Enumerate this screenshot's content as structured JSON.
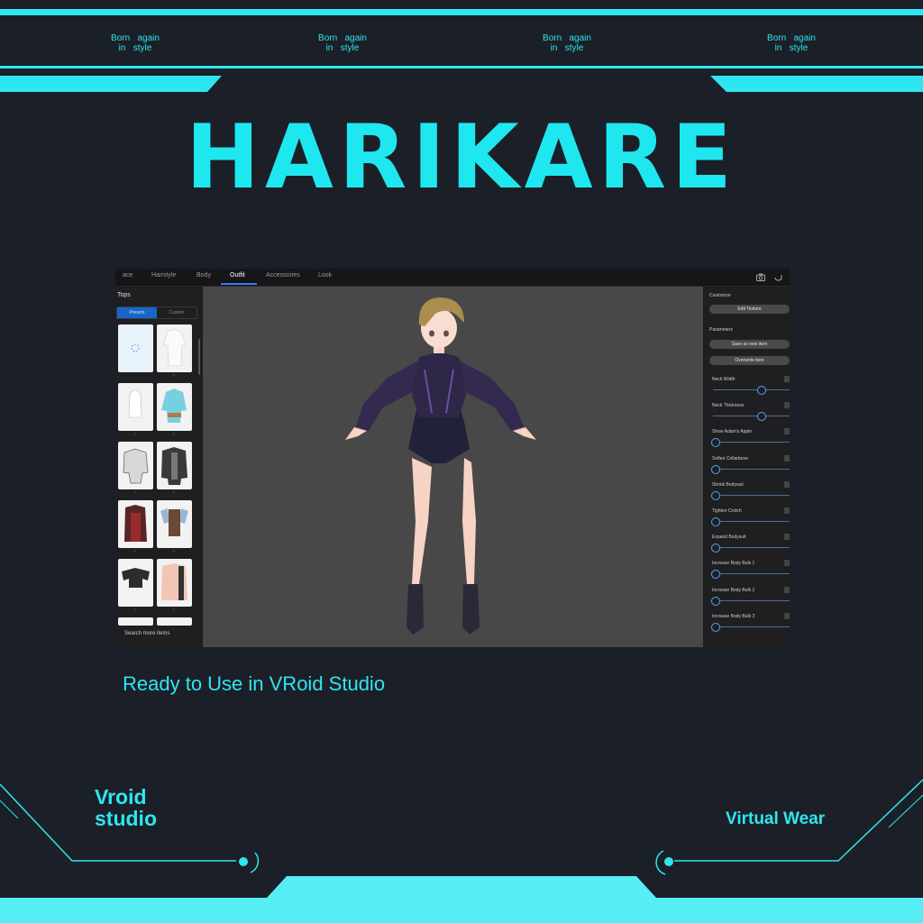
{
  "tagline": {
    "word1": "Born",
    "word2": "again",
    "word3": "in",
    "word4": "style"
  },
  "title": "HARIKARE",
  "subtitle": "Ready to Use in VRoid Studio",
  "brand_left": {
    "line1": "Vroid",
    "line2": "studio"
  },
  "brand_right": "Virtual Wear",
  "colors": {
    "accent": "#2ee6f0",
    "background": "#1b1f27",
    "tab_active": "#2f7cf6"
  },
  "app": {
    "tabs": [
      {
        "label": "ace"
      },
      {
        "label": "Hairstyle"
      },
      {
        "label": "Body"
      },
      {
        "label": "Outfit",
        "active": true
      },
      {
        "label": "Accessories"
      },
      {
        "label": "Look"
      }
    ],
    "toolbar_icons": [
      "camera-icon",
      "undo-icon"
    ],
    "left_panel": {
      "title": "Tops",
      "segments": [
        "Presets",
        "Custom"
      ],
      "search_more": "Search more items",
      "check_mark": "✓"
    },
    "right_panel": {
      "customize_label": "Customize",
      "edit_texture": "Edit Texture",
      "parameters_label": "Parameters",
      "save_as_new": "Save as new item",
      "overwrite": "Overwrite item",
      "sliders": [
        {
          "label": "Neck Width",
          "value": 0.6
        },
        {
          "label": "Neck Thickness",
          "value": 0.6
        },
        {
          "label": "Show Adam's Apple",
          "value": 0
        },
        {
          "label": "Soften Collarbone",
          "value": 0
        },
        {
          "label": "Shrink Bodysuit",
          "value": 0
        },
        {
          "label": "Tighten Crotch",
          "value": 0
        },
        {
          "label": "Expand Bodysuit",
          "value": 0
        },
        {
          "label": "Increase Body Bulk 1",
          "value": 0
        },
        {
          "label": "Increase Body Bulk 2",
          "value": 0
        },
        {
          "label": "Increase Body Bulk 3",
          "value": 0
        }
      ]
    }
  }
}
